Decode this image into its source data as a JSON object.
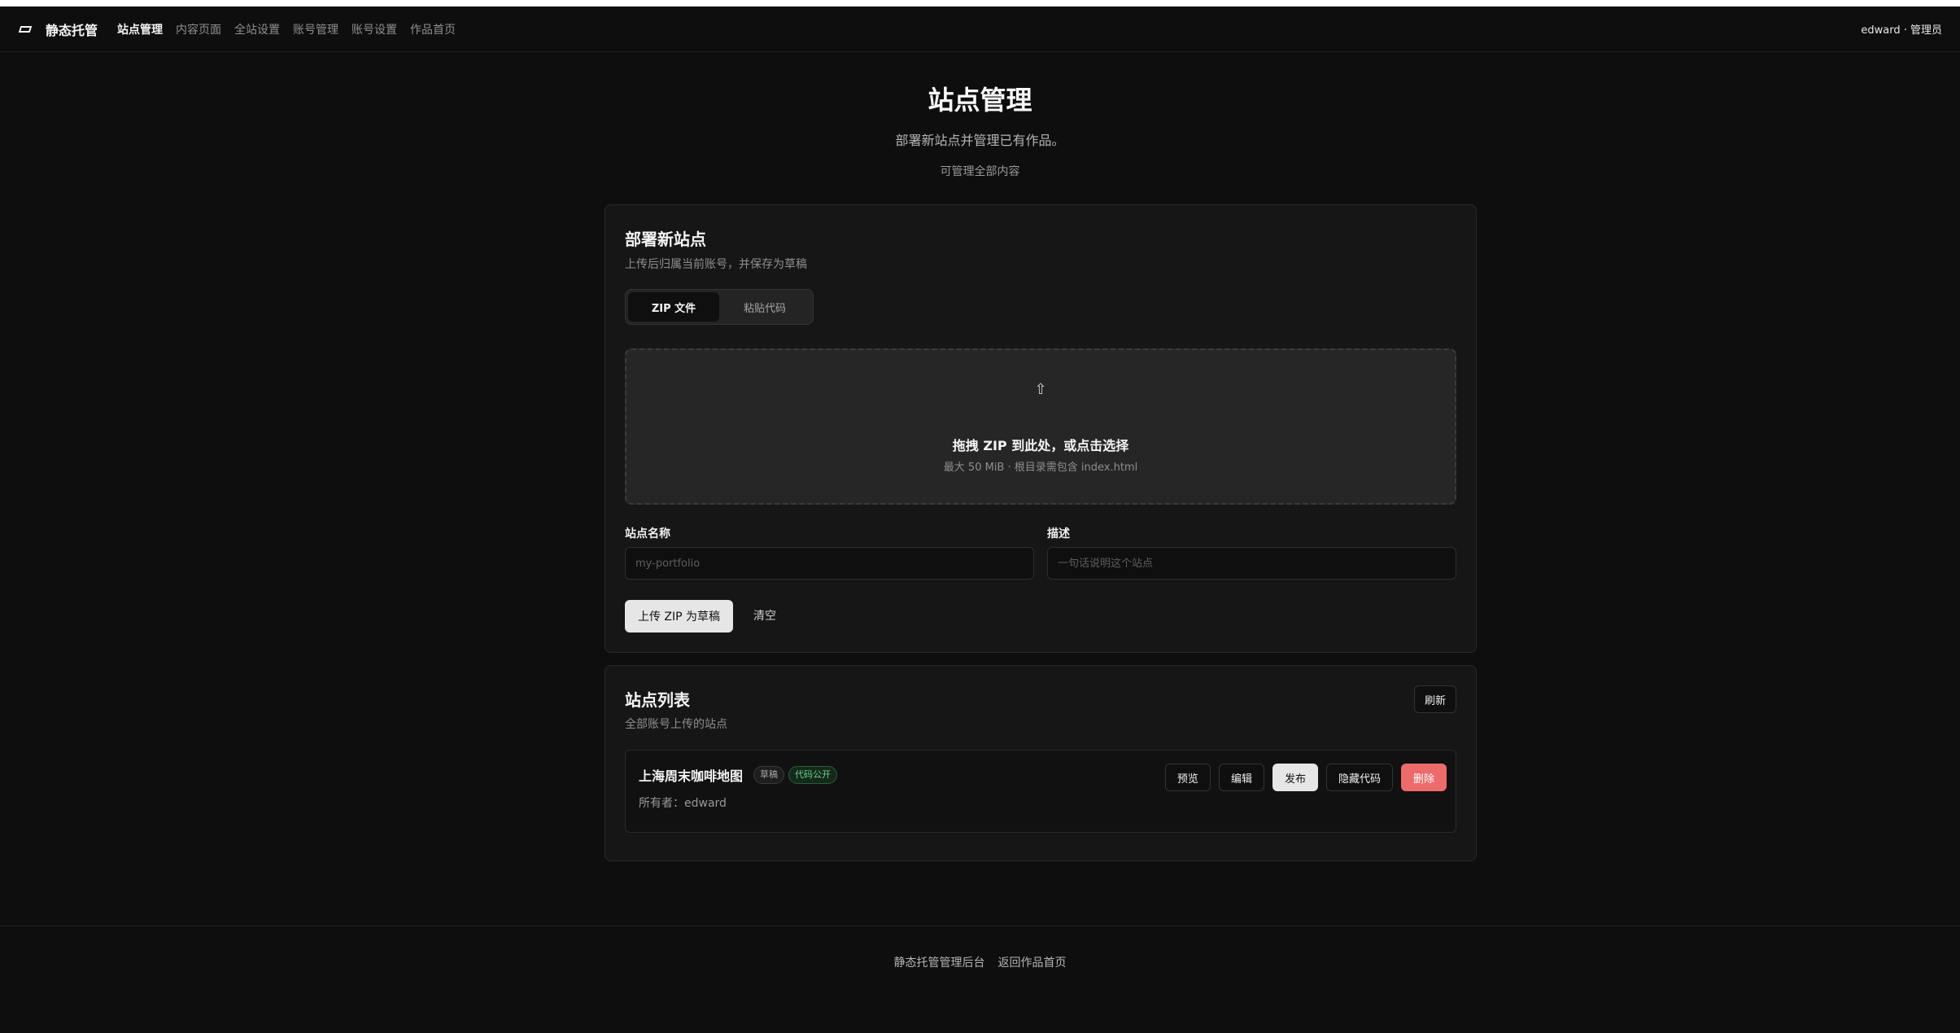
{
  "nav": {
    "brand": "静态托管",
    "links": [
      "站点管理",
      "内容页面",
      "全站设置",
      "账号管理",
      "账号设置",
      "作品首页"
    ],
    "user": "edward · 管理员"
  },
  "header": {
    "title": "站点管理",
    "subtitle": "部署新站点并管理已有作品。",
    "note": "可管理全部内容"
  },
  "deploy": {
    "title": "部署新站点",
    "desc": "上传后归属当前账号，并保存为草稿",
    "tabs": [
      "ZIP 文件",
      "粘贴代码"
    ],
    "dropzone_icon": "⇧",
    "dropzone_title": "拖拽 ZIP 到此处，或点击选择",
    "dropzone_hint": "最大 50 MiB · 根目录需包含 index.html",
    "name_label": "站点名称",
    "name_placeholder": "my-portfolio",
    "desc_label": "描述",
    "desc_placeholder": "一句话说明这个站点",
    "submit_label": "上传 ZIP 为草稿",
    "clear_label": "清空"
  },
  "sites": {
    "title": "站点列表",
    "desc": "全部账号上传的站点",
    "refresh_label": "刷新",
    "items": [
      {
        "name": "上海周末咖啡地图",
        "badge_draft": "草稿",
        "badge_public": "代码公开",
        "owner": "所有者：edward",
        "actions": [
          "预览",
          "编辑",
          "发布",
          "隐藏代码",
          "删除"
        ]
      }
    ]
  },
  "footer": {
    "links": [
      "静态托管管理后台",
      "返回作品首页"
    ]
  }
}
